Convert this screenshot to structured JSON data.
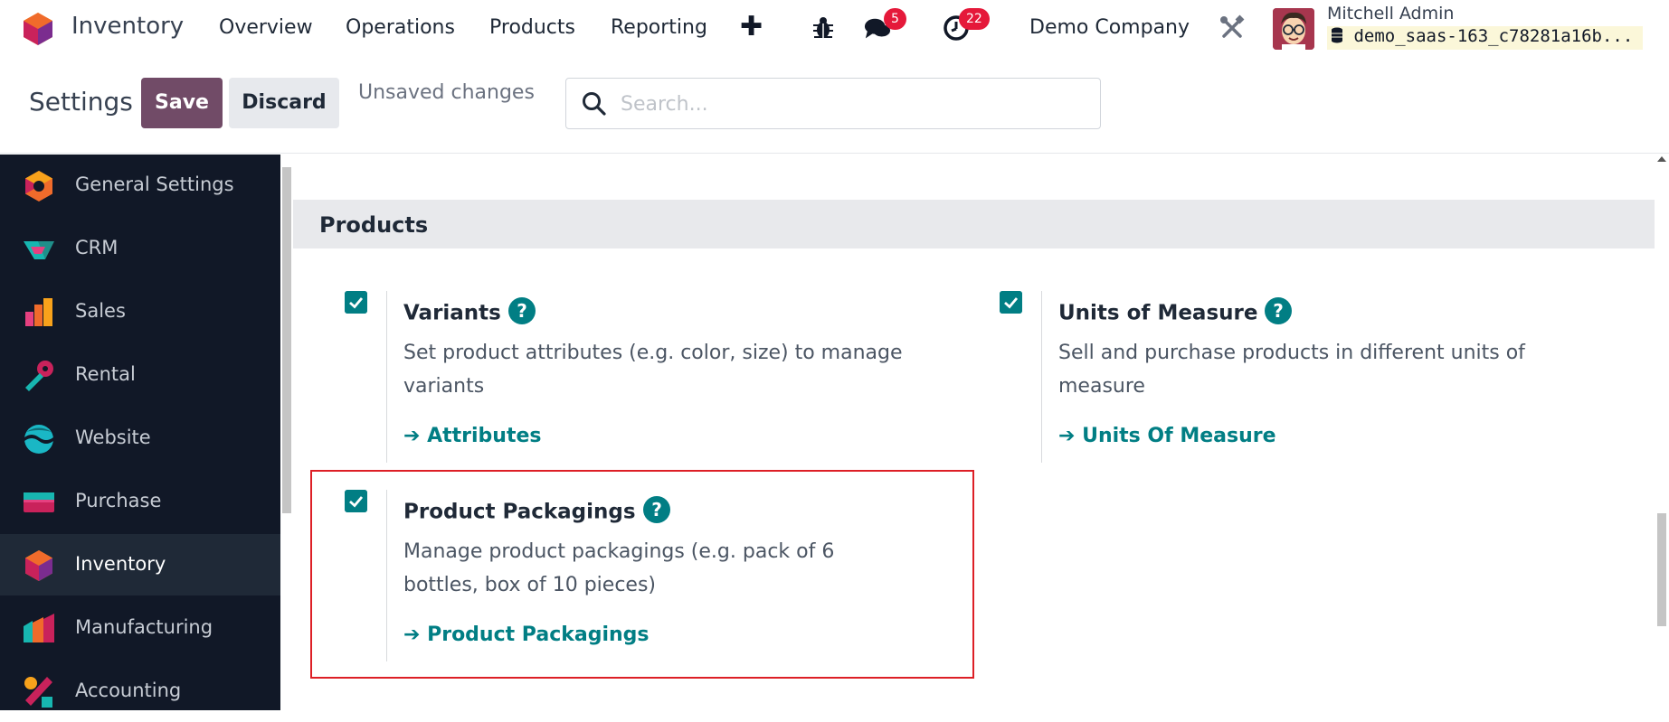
{
  "app": {
    "name": "Inventory",
    "logo_icon": "inventory-hexagon-icon"
  },
  "top_menu": [
    {
      "label": "Overview"
    },
    {
      "label": "Operations"
    },
    {
      "label": "Products"
    },
    {
      "label": "Reporting"
    }
  ],
  "systray": {
    "new_icon": "plus-icon",
    "debug_icon": "bug-icon",
    "messages_icon": "chat-bubbles-icon",
    "messages_count": "5",
    "activities_icon": "clock-icon",
    "activities_count": "22",
    "company": "Demo Company",
    "settings_icon": "tools-icon",
    "user_name": "Mitchell Admin",
    "database": "demo_saas-163_c78281a16b..."
  },
  "control_panel": {
    "title": "Settings",
    "save_label": "Save",
    "discard_label": "Discard",
    "status": "Unsaved changes",
    "search_placeholder": "Search..."
  },
  "sidebar": {
    "items": [
      {
        "label": "General Settings",
        "icon": "general-settings-icon"
      },
      {
        "label": "CRM",
        "icon": "crm-icon"
      },
      {
        "label": "Sales",
        "icon": "sales-icon"
      },
      {
        "label": "Rental",
        "icon": "rental-icon"
      },
      {
        "label": "Website",
        "icon": "website-icon"
      },
      {
        "label": "Purchase",
        "icon": "purchase-icon"
      },
      {
        "label": "Inventory",
        "icon": "inventory-icon",
        "active": true
      },
      {
        "label": "Manufacturing",
        "icon": "manufacturing-icon"
      },
      {
        "label": "Accounting",
        "icon": "accounting-icon"
      }
    ]
  },
  "section": {
    "title": "Products",
    "settings": [
      {
        "title": "Variants",
        "checked": true,
        "description": "Set product attributes (e.g. color, size) to manage variants",
        "link": "Attributes"
      },
      {
        "title": "Units of Measure",
        "checked": true,
        "description": "Sell and purchase products in different units of measure",
        "link": "Units Of Measure"
      },
      {
        "title": "Product Packagings",
        "checked": true,
        "description": "Manage product packagings (e.g. pack of 6 bottles, box of 10 pieces)",
        "link": "Product Packagings"
      }
    ]
  },
  "colors": {
    "brand": "#714b67",
    "accent": "#017e84",
    "sidebar_bg": "#111827",
    "badge": "#e5193a",
    "highlight": "#dd1f26"
  }
}
